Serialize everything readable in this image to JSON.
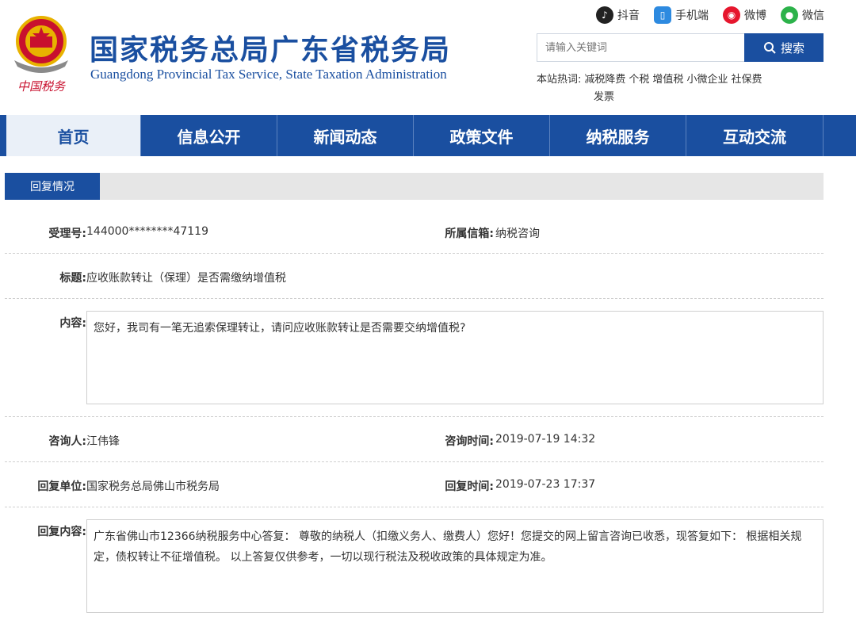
{
  "header": {
    "title": "国家税务总局广东省税务局",
    "subtitle": "Guangdong Provincial Tax Service, State Taxation Administration",
    "logo_text": "中国税务"
  },
  "social": [
    {
      "label": "抖音",
      "icon": "tiktok-icon",
      "color": "#222222"
    },
    {
      "label": "手机端",
      "icon": "mobile-icon",
      "color": "#2d8ae0"
    },
    {
      "label": "微博",
      "icon": "weibo-icon",
      "color": "#e6162d"
    },
    {
      "label": "微信",
      "icon": "wechat-icon",
      "color": "#2cb24a"
    }
  ],
  "search": {
    "placeholder": "请输入关键词",
    "button_label": "搜索"
  },
  "hot": {
    "label": "本站热词:",
    "links": [
      "减税降费",
      "个税",
      "增值税",
      "小微企业",
      "社保费",
      "发票"
    ]
  },
  "nav": [
    "首页",
    "信息公开",
    "新闻动态",
    "政策文件",
    "纳税服务",
    "互动交流"
  ],
  "section_tab": "回复情况",
  "record": {
    "case_no_label": "受理号:",
    "case_no": "144000********47119",
    "mailbox_label": "所属信箱:",
    "mailbox": "纳税咨询",
    "title_label": "标题:",
    "title": "应收账款转让（保理）是否需缴纳增值税",
    "content_label": "内容:",
    "content": "您好，我司有一笔无追索保理转让，请问应收账款转让是否需要交纳增值税?",
    "asker_label": "咨询人:",
    "asker": "江伟锋",
    "ask_time_label": "咨询时间:",
    "ask_time": "2019-07-19 14:32",
    "reply_unit_label": "回复单位:",
    "reply_unit": "国家税务总局佛山市税务局",
    "reply_time_label": "回复时间:",
    "reply_time": "2019-07-23 17:37",
    "reply_content_label": "回复内容:",
    "reply_content": "广东省佛山市12366纳税服务中心答复： 尊敬的纳税人（扣缴义务人、缴费人）您好！您提交的网上留言咨询已收悉，现答复如下： 根据相关规定，债权转让不征增值税。 以上答复仅供参考，一切以现行税法及税收政策的具体规定为准。"
  },
  "colors": {
    "brand": "#1a4fa0",
    "nav_active_bg": "#eaf0f8"
  }
}
